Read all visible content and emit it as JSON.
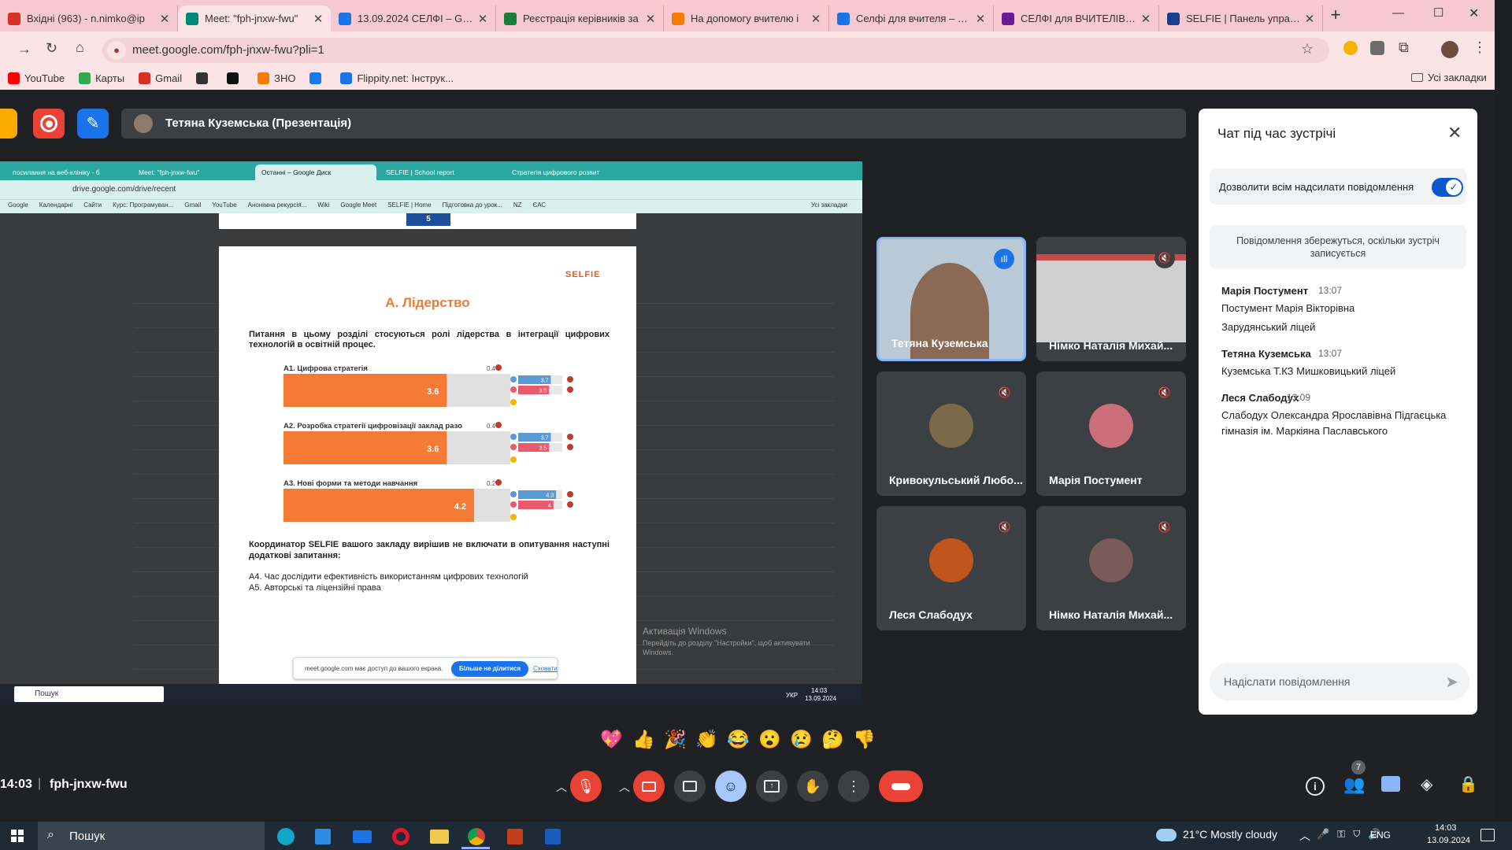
{
  "browser": {
    "tabs": [
      {
        "title": "Вхідні (963) - n.nimko@ip",
        "icon": "gmail-icon",
        "color": "#d93025"
      },
      {
        "title": "Meet: \"fph-jnxw-fwu\"",
        "icon": "meet-icon",
        "color": "#00897b",
        "active": true
      },
      {
        "title": "13.09.2024 СЕЛФІ – Goog",
        "icon": "drive-icon",
        "color": "#1a73e8"
      },
      {
        "title": "Реєстрація керівників за",
        "icon": "sheets-icon",
        "color": "#188038"
      },
      {
        "title": "На допомогу вчителю і",
        "icon": "blogger-icon",
        "color": "#f57c00"
      },
      {
        "title": "Селфі для вчителя – Goo",
        "icon": "drive-icon",
        "color": "#1a73e8"
      },
      {
        "title": "СЕЛФІ для ВЧИТЕЛІВ - Є",
        "icon": "forms-icon",
        "color": "#6a1b9a"
      },
      {
        "title": "SELFIE | Панель управлін",
        "icon": "eu-icon",
        "color": "#1a3d8f"
      }
    ],
    "new_tab": "+",
    "window_controls": [
      "—",
      "☐",
      "✕"
    ],
    "address": "meet.google.com/fph-jnxw-fwu?pli=1",
    "bookmarks": [
      {
        "label": "YouTube",
        "icon": "youtube-icon",
        "color": "#ff0000"
      },
      {
        "label": "Карты",
        "icon": "maps-icon",
        "color": "#34a853"
      },
      {
        "label": "Gmail",
        "icon": "gmail-icon",
        "color": "#d93025"
      },
      {
        "label": "",
        "icon": "history-icon",
        "color": "#333333"
      },
      {
        "label": "",
        "icon": "globe-icon",
        "color": "#111111"
      },
      {
        "label": "ЗНО",
        "icon": "blogger-icon",
        "color": "#f57c00"
      },
      {
        "label": "",
        "icon": "facebook-icon",
        "color": "#1877f2"
      },
      {
        "label": "Flippity.net: Інструк...",
        "icon": "flippity-icon",
        "color": "#1a73e8"
      }
    ],
    "all_bookmarks": "Усі закладки"
  },
  "meet": {
    "presenter_bar": "Тетяна Куземська (Презентація)",
    "time": "14:03",
    "separator": "|",
    "code": "fph-jnxw-fwu",
    "people_count": "7",
    "tiles": [
      {
        "name": "Тетяна Куземська",
        "active": true
      },
      {
        "name": "Німко Наталія Михай..."
      },
      {
        "name": "Кривокульський Любо..."
      },
      {
        "name": "Марія Постумент"
      },
      {
        "name": "Леся Слабодух"
      },
      {
        "name": "Німко Наталія Михай..."
      }
    ],
    "reactions": [
      "💖",
      "👍",
      "🎉",
      "👏",
      "😂",
      "😮",
      "😢",
      "🤔",
      "👎"
    ]
  },
  "chat": {
    "title": "Чат під час зустрічі",
    "allow_label": "Дозволити всім надсилати повідомлення",
    "notice": "Повідомлення збережуться, оскільки зустріч записується",
    "messages": [
      {
        "author": "Марія Постумент",
        "time": "13:07",
        "lines": [
          "Постумент Марія Вікторівна",
          "Зарудянський ліцей"
        ]
      },
      {
        "author": "Тетяна Куземська",
        "time": "13:07",
        "lines": [
          "Куземська Т.КЗ Мишковицький ліцей"
        ]
      },
      {
        "author": "Леся Слабодух",
        "time": "13:09",
        "lines": [
          "Слабодух Олександра Ярославівна Підгаєцька",
          "гімназія ім. Маркіяна Паславського"
        ]
      }
    ],
    "input_placeholder": "Надіслати повідомлення"
  },
  "shared": {
    "tabs": [
      "посилання на веб-клініку - б",
      "Meet: \"fph-jnxw-fwu\"",
      "Останні – Google Диск",
      "SELFIE | School report",
      "Стратегія цифрового розвит"
    ],
    "address": "drive.google.com/drive/recent",
    "bookmarks": [
      "Google",
      "Календарні",
      "Сайти",
      "Курс: Програмуван...",
      "Gmail",
      "YouTube",
      "Анонімна рекурсія...",
      "Wiki",
      "Google Meet",
      "SELFIE | Home",
      "Підготовка до урок...",
      "NZ",
      "ЄАС",
      "Усі закладки"
    ],
    "page_num": "5",
    "doc": {
      "logo": "SELFIE",
      "heading": "A. Лідерство",
      "intro": "Питання в цьому розділі стосуються ролі лідерства в інтеграції цифрових технологій в освітній процес.",
      "items": [
        {
          "label": "A1. Цифрова стратегія",
          "diff": "0.4",
          "value": 3.6,
          "value_label": "3.6",
          "sub": [
            {
              "v": "3.7",
              "c": "#5b9bd5"
            },
            {
              "v": "3.5",
              "c": "#e85a6e"
            }
          ]
        },
        {
          "label": "A2. Розробка стратегії цифровізації заклад разо",
          "diff": "0.4",
          "value": 3.6,
          "value_label": "3.6",
          "sub": [
            {
              "v": "3.7",
              "c": "#5b9bd5"
            },
            {
              "v": "3.5",
              "c": "#e85a6e"
            }
          ]
        },
        {
          "label": "A3. Нові форми та методи навчання",
          "diff": "0.2",
          "value": 4.2,
          "value_label": "4.2",
          "sub": [
            {
              "v": "4.3",
              "c": "#5b9bd5"
            },
            {
              "v": "4",
              "c": "#e85a6e"
            }
          ]
        }
      ],
      "max": 5,
      "footer": "Координатор SELFIE вашого закладу вирішив не включати в опитування наступні додаткові запитання:",
      "extra": [
        "A4. Час дослідити ефективність використанням цифрових технологій",
        "A5. Авторські та ліцензійні права"
      ],
      "share_text": "meet.google.com має доступ до вашого екрана.",
      "stop_share": "Більше не ділитися",
      "hide": "Сховати"
    },
    "activate_title": "Активація Windows",
    "activate_sub": "Перейдіть до розділу \"Настройки\", щоб активувати Windows.",
    "tb_search": "Пошук",
    "tb_lang": "УКР",
    "tb_time": "14:03",
    "tb_date": "13.09.2024"
  },
  "taskbar": {
    "search": "Пошук",
    "weather": "21°C  Mostly cloudy",
    "lang": "ENG",
    "time": "14:03",
    "date": "13.09.2024"
  }
}
